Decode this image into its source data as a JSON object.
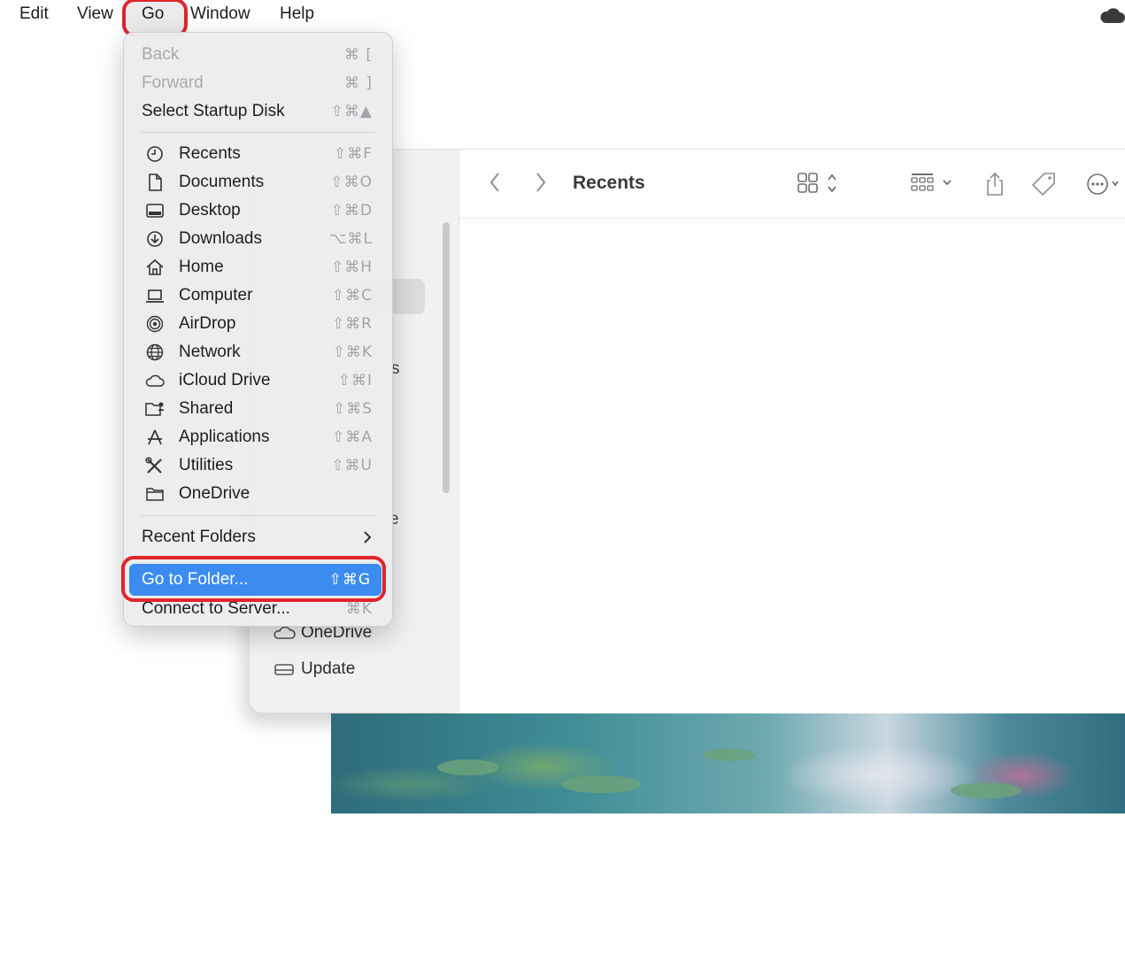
{
  "menubar": {
    "items": [
      "Edit",
      "View",
      "Go",
      "Window",
      "Help"
    ]
  },
  "go_menu": {
    "nav_items": [
      {
        "label": "Back",
        "shortcut": "⌘ [",
        "disabled": true
      },
      {
        "label": "Forward",
        "shortcut": "⌘ ]",
        "disabled": true
      },
      {
        "label": "Select Startup Disk",
        "shortcut": "⇧⌘▲",
        "disabled": false
      }
    ],
    "location_items": [
      {
        "label": "Recents",
        "shortcut": "⇧⌘F",
        "icon": "clock-icon"
      },
      {
        "label": "Documents",
        "shortcut": "⇧⌘O",
        "icon": "document-icon"
      },
      {
        "label": "Desktop",
        "shortcut": "⇧⌘D",
        "icon": "desktop-icon"
      },
      {
        "label": "Downloads",
        "shortcut": "⌥⌘L",
        "icon": "download-icon"
      },
      {
        "label": "Home",
        "shortcut": "⇧⌘H",
        "icon": "home-icon"
      },
      {
        "label": "Computer",
        "shortcut": "⇧⌘C",
        "icon": "laptop-icon"
      },
      {
        "label": "AirDrop",
        "shortcut": "⇧⌘R",
        "icon": "airdrop-icon"
      },
      {
        "label": "Network",
        "shortcut": "⇧⌘K",
        "icon": "globe-icon"
      },
      {
        "label": "iCloud Drive",
        "shortcut": "⇧⌘I",
        "icon": "cloud-icon"
      },
      {
        "label": "Shared",
        "shortcut": "⇧⌘S",
        "icon": "shared-folder-icon"
      },
      {
        "label": "Applications",
        "shortcut": "⇧⌘A",
        "icon": "applications-icon"
      },
      {
        "label": "Utilities",
        "shortcut": "⇧⌘U",
        "icon": "utilities-icon"
      },
      {
        "label": "OneDrive",
        "shortcut": "",
        "icon": "folder-icon"
      }
    ],
    "recent_folders": "Recent Folders",
    "go_to_folder": {
      "label": "Go to Folder...",
      "shortcut": "⇧⌘G"
    },
    "connect_to_server": {
      "label": "Connect to Server...",
      "shortcut": "⌘K"
    }
  },
  "finder": {
    "title": "Recents",
    "sidebar": {
      "onedrive": "OneDrive",
      "update": "Update",
      "fragment_s": "s",
      "fragment_e": "e"
    }
  },
  "colors": {
    "highlight": "#3c8cf0",
    "annotation_ring": "#e0242b"
  }
}
